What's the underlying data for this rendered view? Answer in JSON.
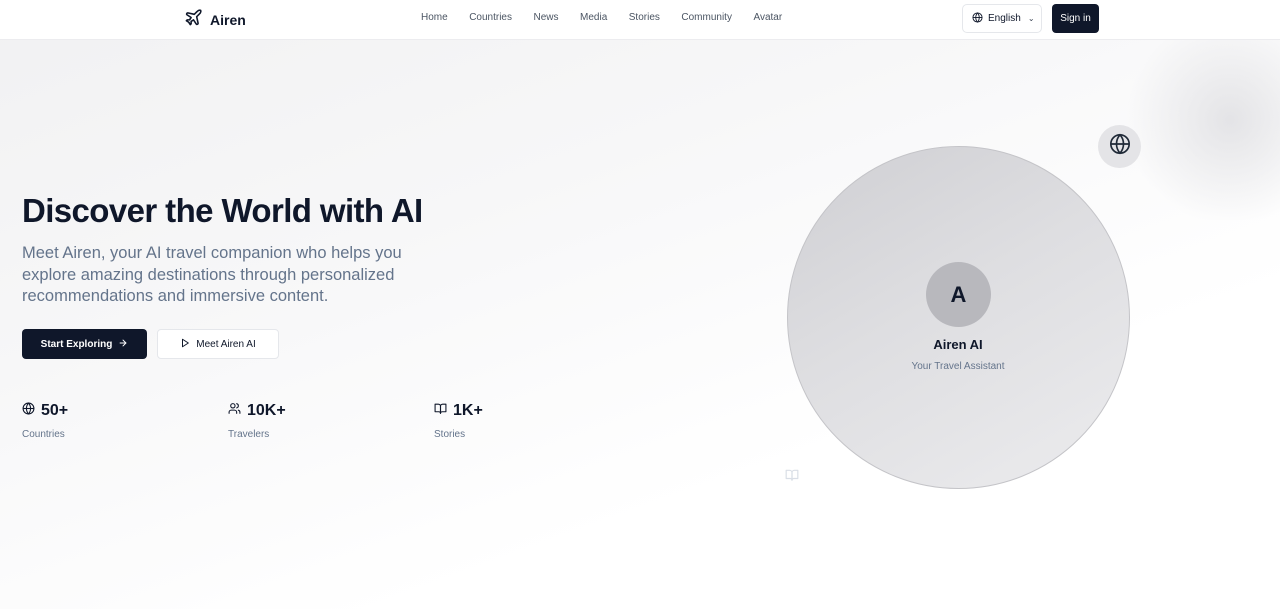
{
  "header": {
    "brand": "Airen",
    "nav": [
      "Home",
      "Countries",
      "News",
      "Media",
      "Stories",
      "Community",
      "Avatar"
    ],
    "language": "English",
    "signin_label": "Sign in"
  },
  "hero": {
    "title": "Discover the World with AI",
    "subtitle": "Meet Airen, your AI travel companion who helps you explore amazing destinations through personalized recommendations and immersive content.",
    "primary_button": "Start Exploring",
    "secondary_button": "Meet Airen AI"
  },
  "stats": [
    {
      "icon": "globe-icon",
      "value": "50+",
      "label": "Countries"
    },
    {
      "icon": "users-icon",
      "value": "10K+",
      "label": "Travelers"
    },
    {
      "icon": "book-icon",
      "value": "1K+",
      "label": "Stories"
    }
  ],
  "assistant": {
    "initial": "A",
    "name": "Airen AI",
    "role": "Your Travel Assistant"
  },
  "colors": {
    "primary": "#0f172a",
    "muted_text": "#64748b",
    "circle": "#dedee1"
  }
}
